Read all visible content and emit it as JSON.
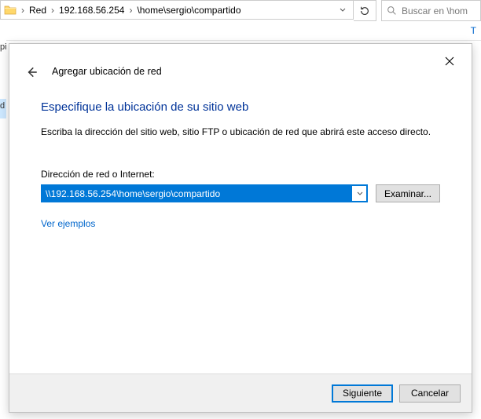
{
  "explorer": {
    "segments": [
      "Red",
      "192.168.56.254",
      "\\home\\sergio\\compartido"
    ],
    "search_placeholder": "Buscar en \\hom",
    "side_letter": "T"
  },
  "gutter": [
    "pi",
    "",
    "",
    "d"
  ],
  "dialog": {
    "title": "Agregar ubicación de red",
    "heading": "Especifique la ubicación de su sitio web",
    "instruction": "Escriba la dirección del sitio web, sitio FTP o ubicación de red que abrirá este acceso directo.",
    "field_label": "Dirección de red o Internet:",
    "field_value": "\\\\192.168.56.254\\home\\sergio\\compartido",
    "browse": "Examinar...",
    "examples": "Ver ejemplos",
    "next": "Siguiente",
    "cancel": "Cancelar"
  }
}
